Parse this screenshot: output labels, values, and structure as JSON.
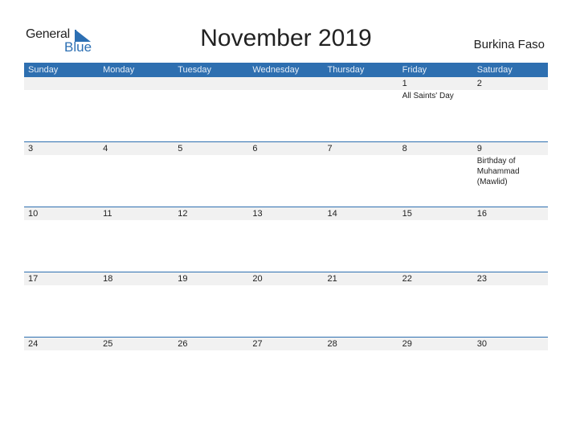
{
  "logo": {
    "general": "General",
    "blue": "Blue",
    "icon": "triangle-flag-icon"
  },
  "title": "November 2019",
  "country": "Burkina Faso",
  "colors": {
    "header": "#2e6fb0",
    "accent": "#2c6fb3",
    "row_band": "#f1f1f1"
  },
  "weekdays": [
    "Sunday",
    "Monday",
    "Tuesday",
    "Wednesday",
    "Thursday",
    "Friday",
    "Saturday"
  ],
  "weeks": [
    {
      "days": [
        "",
        "",
        "",
        "",
        "",
        "1",
        "2"
      ],
      "events": [
        "",
        "",
        "",
        "",
        "",
        "All Saints' Day",
        ""
      ]
    },
    {
      "days": [
        "3",
        "4",
        "5",
        "6",
        "7",
        "8",
        "9"
      ],
      "events": [
        "",
        "",
        "",
        "",
        "",
        "",
        "Birthday of Muhammad (Mawlid)"
      ]
    },
    {
      "days": [
        "10",
        "11",
        "12",
        "13",
        "14",
        "15",
        "16"
      ],
      "events": [
        "",
        "",
        "",
        "",
        "",
        "",
        ""
      ]
    },
    {
      "days": [
        "17",
        "18",
        "19",
        "20",
        "21",
        "22",
        "23"
      ],
      "events": [
        "",
        "",
        "",
        "",
        "",
        "",
        ""
      ]
    },
    {
      "days": [
        "24",
        "25",
        "26",
        "27",
        "28",
        "29",
        "30"
      ],
      "events": [
        "",
        "",
        "",
        "",
        "",
        "",
        ""
      ]
    }
  ]
}
